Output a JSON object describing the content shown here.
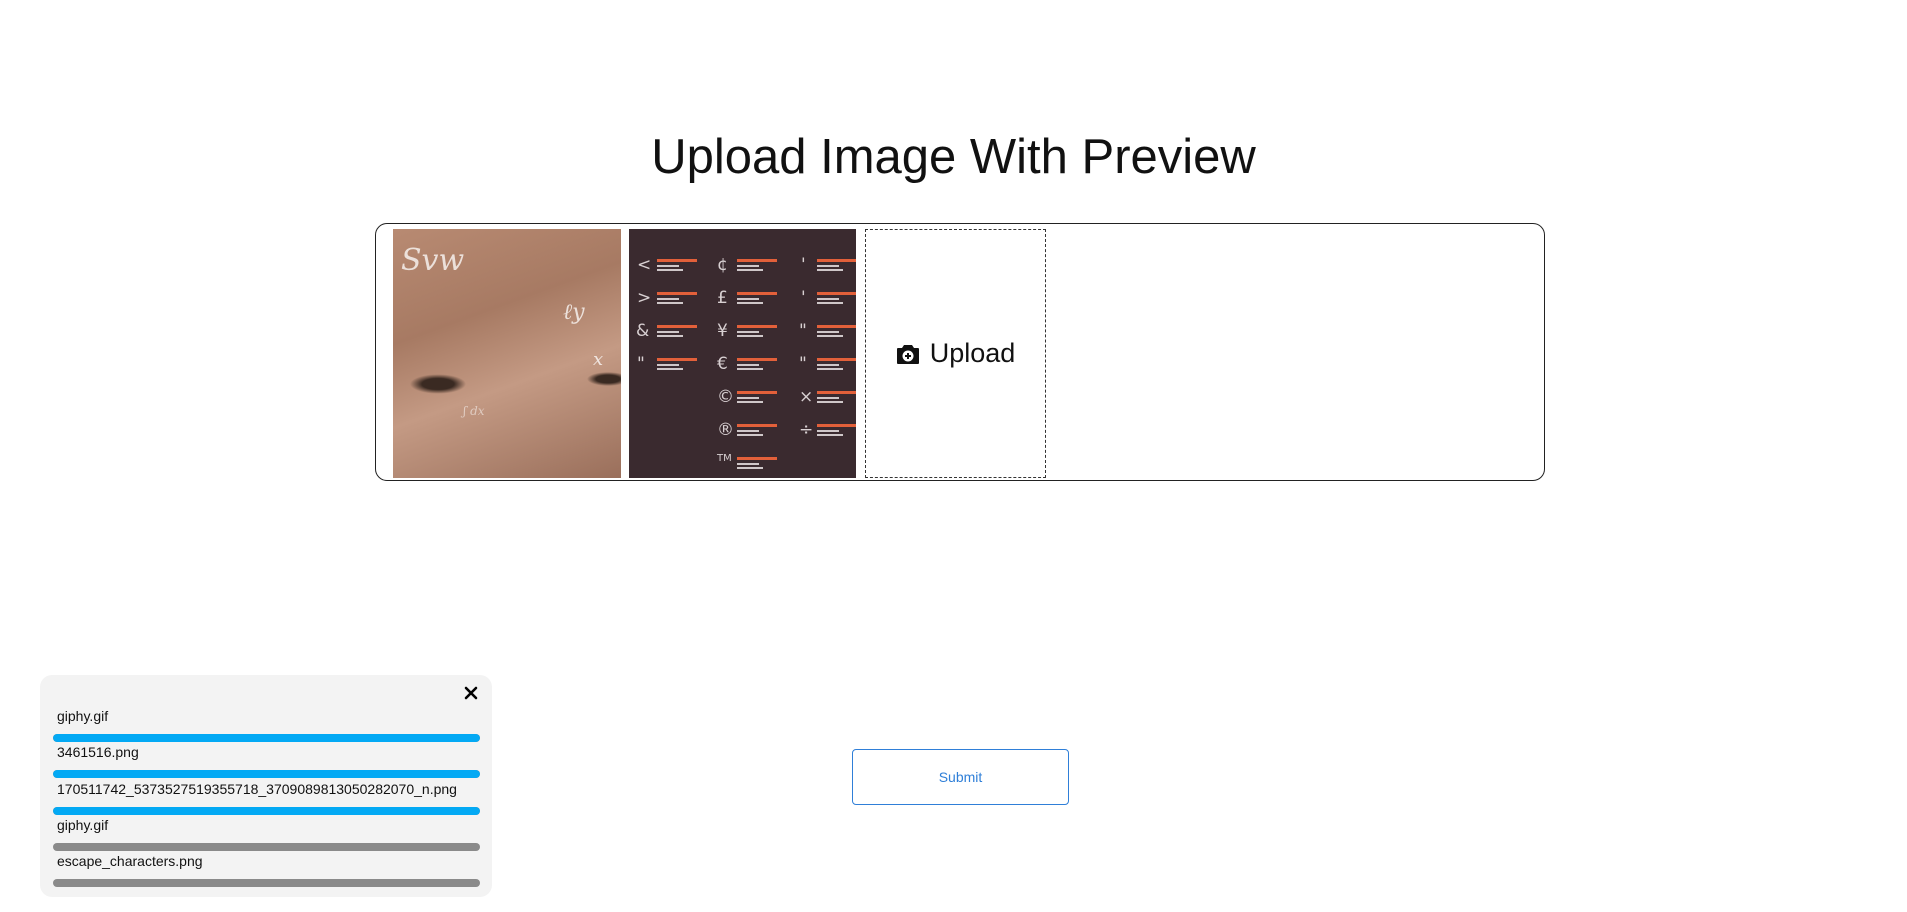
{
  "page": {
    "title": "Upload Image With Preview"
  },
  "previews": [
    {
      "name": "giphy.gif",
      "kind": "face-image"
    },
    {
      "name": "escape_characters.png",
      "kind": "characters-image"
    }
  ],
  "upload_tile": {
    "label": "Upload",
    "icon": "camera-plus-icon"
  },
  "submit": {
    "label": "Submit"
  },
  "upload_panel": {
    "close_icon": "close-icon",
    "files": [
      {
        "name": "giphy.gif",
        "progress": 1.0,
        "color": "#03a9f4"
      },
      {
        "name": "3461516.png",
        "progress": 1.0,
        "color": "#03a9f4"
      },
      {
        "name": "170511742_5373527519355718_3709089813050282070_n.png",
        "progress": 1.0,
        "color": "#03a9f4"
      },
      {
        "name": "giphy.gif",
        "progress": 0.0,
        "color": "#8a8a8a"
      },
      {
        "name": "escape_characters.png",
        "progress": 0.0,
        "color": "#8a8a8a"
      }
    ]
  },
  "colors": {
    "accent": "#2f7fd8",
    "progress_done": "#03a9f4",
    "progress_pending": "#8a8a8a"
  }
}
